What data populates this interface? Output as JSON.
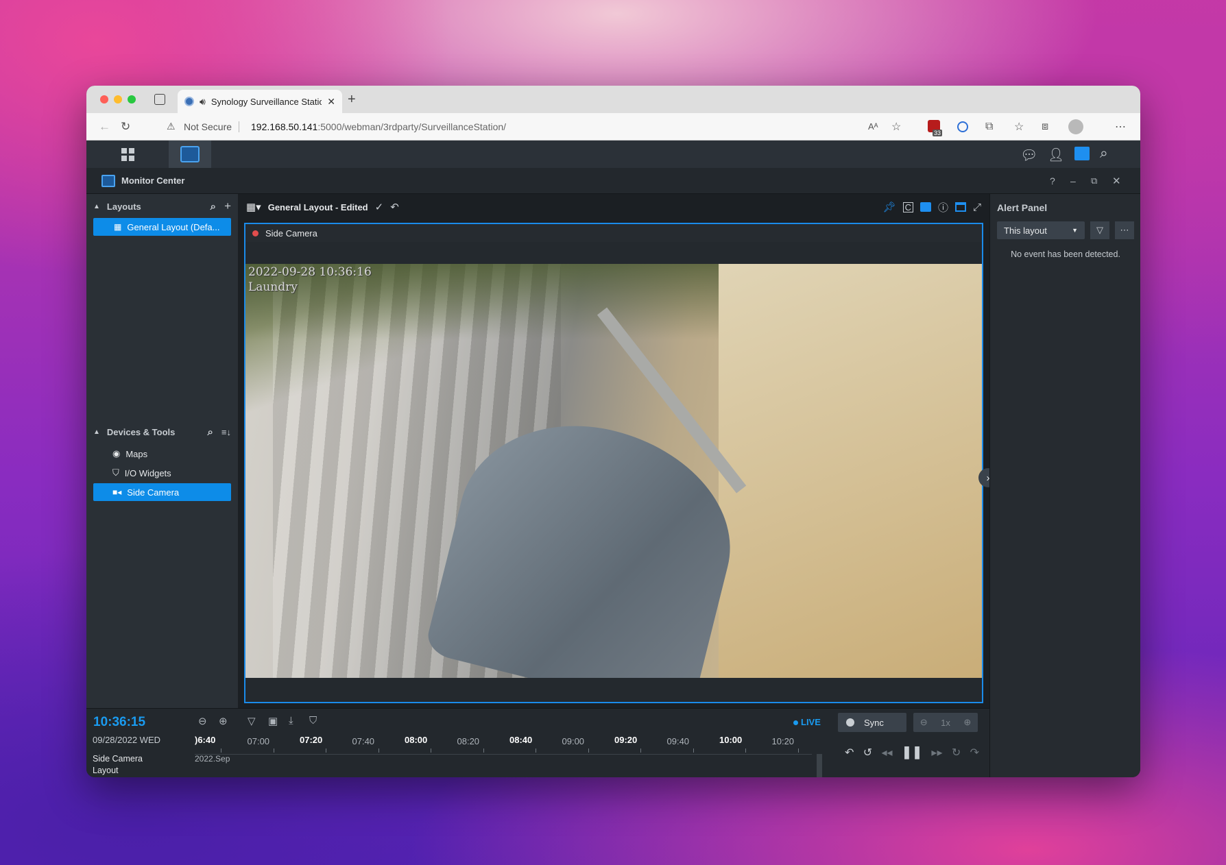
{
  "browser": {
    "tab_title": "Synology Surveillance Station",
    "security_label": "Not Secure",
    "url_host": "192.168.50.141",
    "url_path": ":5000/webman/3rdparty/SurveillanceStation/",
    "extension_badge": "33"
  },
  "app": {
    "title": "Monitor Center",
    "help": "?"
  },
  "layouts": {
    "header": "Layouts",
    "items": [
      {
        "label": "General Layout (Defa..."
      }
    ]
  },
  "devices": {
    "header": "Devices & Tools",
    "items": [
      {
        "label": "Maps",
        "icon": "map-pin-icon"
      },
      {
        "label": "I/O Widgets",
        "icon": "io-widget-icon"
      },
      {
        "label": "Side Camera",
        "icon": "camera-icon"
      }
    ]
  },
  "view": {
    "layout_name": "General Layout - Edited",
    "camera_name": "Side Camera",
    "osd_timestamp": "2022-09-28 10:36:16",
    "osd_label": "Laundry"
  },
  "alert": {
    "title": "Alert Panel",
    "filter_value": "This layout",
    "empty_message": "No event has been detected."
  },
  "timeline": {
    "clock": "10:36:15",
    "date": "09/28/2022 WED",
    "live": "LIVE",
    "sync": "Sync",
    "speed": "1x",
    "rows": [
      "Side Camera",
      "Layout"
    ],
    "row_date": "2022.Sep",
    "ticks": [
      {
        "label": ")6:40",
        "bold": true
      },
      {
        "label": "07:00",
        "bold": false
      },
      {
        "label": "07:20",
        "bold": true
      },
      {
        "label": "07:40",
        "bold": false
      },
      {
        "label": "08:00",
        "bold": true
      },
      {
        "label": "08:20",
        "bold": false
      },
      {
        "label": "08:40",
        "bold": true
      },
      {
        "label": "09:00",
        "bold": false
      },
      {
        "label": "09:20",
        "bold": true
      },
      {
        "label": "09:40",
        "bold": false
      },
      {
        "label": "10:00",
        "bold": true
      },
      {
        "label": "10:20",
        "bold": false
      }
    ]
  },
  "colors": {
    "accent": "#0d8ce8",
    "live": "#1a9bf0",
    "record": "#e14d4d"
  }
}
